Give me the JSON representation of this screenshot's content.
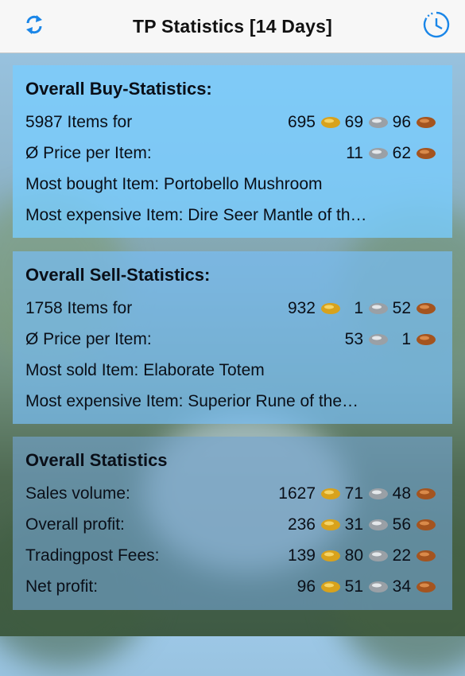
{
  "nav": {
    "title": "TP Statistics [14 Days]"
  },
  "icons": {
    "refresh": "refresh-arrows-icon",
    "history": "clock-history-icon",
    "gold": "gold-coin-icon",
    "silver": "silver-coin-icon",
    "copper": "copper-coin-icon"
  },
  "colors": {
    "accent": "#1a86e8",
    "gold": "#d8a21c",
    "silver": "#9aa0a6",
    "copper": "#a4541f"
  },
  "buy": {
    "title": "Overall Buy-Statistics:",
    "items_label": "5987 Items for",
    "items_price": {
      "g": "695",
      "s": "69",
      "c": "96"
    },
    "avg_label": "Ø Price per Item:",
    "avg_price": {
      "s": "11",
      "c": "62"
    },
    "most_bought": "Most bought Item: Portobello Mushroom",
    "most_expensive": "Most expensive Item: Dire Seer Mantle of th…"
  },
  "sell": {
    "title": "Overall Sell-Statistics:",
    "items_label": "1758 Items for",
    "items_price": {
      "g": "932",
      "s": "1",
      "c": "52"
    },
    "avg_label": "Ø Price per Item:",
    "avg_price": {
      "s": "53",
      "c": "1"
    },
    "most_sold": "Most sold Item: Elaborate Totem",
    "most_expensive": "Most expensive Item: Superior Rune of the…"
  },
  "overall": {
    "title": "Overall Statistics",
    "rows": [
      {
        "label": "Sales volume:",
        "g": "1627",
        "s": "71",
        "c": "48"
      },
      {
        "label": "Overall profit:",
        "g": "236",
        "s": "31",
        "c": "56"
      },
      {
        "label": "Tradingpost Fees:",
        "g": "139",
        "s": "80",
        "c": "22"
      },
      {
        "label": "Net profit:",
        "g": "96",
        "s": "51",
        "c": "34"
      }
    ]
  }
}
